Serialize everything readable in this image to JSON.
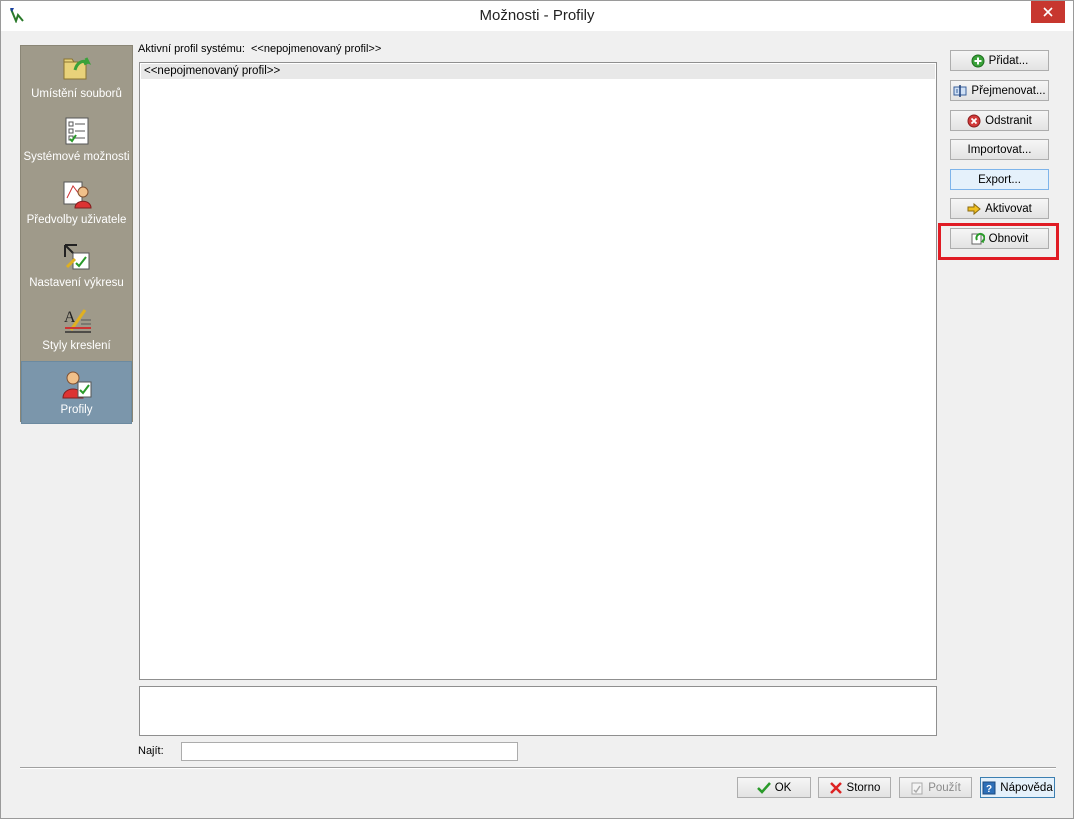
{
  "window": {
    "title": "Možnosti - Profily",
    "close_icon": "close-icon"
  },
  "sidebar": {
    "items": [
      {
        "label": "Umístění souborů",
        "icon": "folder-open-icon"
      },
      {
        "label": "Systémové možnosti",
        "icon": "checklist-icon"
      },
      {
        "label": "Předvolby uživatele",
        "icon": "user-preferences-icon"
      },
      {
        "label": "Nastavení výkresu",
        "icon": "drawing-settings-icon"
      },
      {
        "label": "Styly kreslení",
        "icon": "drawing-styles-icon"
      },
      {
        "label": "Profily",
        "icon": "profiles-icon",
        "active": true
      }
    ]
  },
  "main": {
    "active_profile_label": "Aktivní profil systému:",
    "active_profile_value": "<<nepojmenovaný profil>>",
    "profiles": [
      "<<nepojmenovaný profil>>"
    ],
    "description": "",
    "find_label": "Najít:",
    "find_value": ""
  },
  "actions": {
    "add": "Přidat...",
    "rename": "Přejmenovat...",
    "delete": "Odstranit",
    "import": "Importovat...",
    "export": "Export...",
    "activate": "Aktivovat",
    "refresh": "Obnovit"
  },
  "footer": {
    "ok": "OK",
    "cancel": "Storno",
    "apply": "Použít",
    "help": "Nápověda"
  },
  "colors": {
    "sidebar_bg": "#9f9a8a",
    "sidebar_active": "#7b96ab",
    "highlight": "#e01b24",
    "close_button": "#c7372f"
  }
}
